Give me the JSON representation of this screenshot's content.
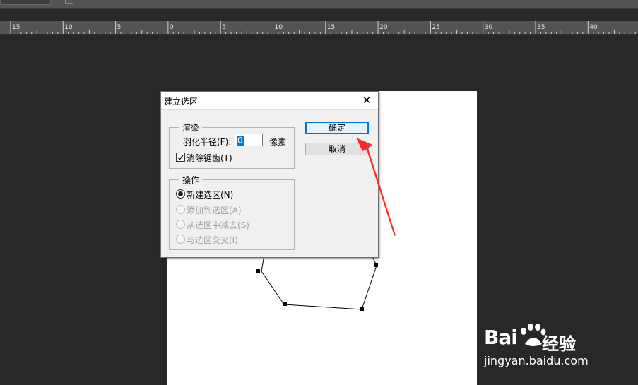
{
  "ruler": {
    "labels": [
      "15",
      "10",
      "5",
      "0",
      "5",
      "10",
      "15",
      "20",
      "25",
      "30",
      "35",
      "40"
    ]
  },
  "dialog": {
    "title": "建立选区",
    "close_glyph": "✕",
    "render_group": {
      "legend": "渲染",
      "feather_label": "羽化半径(F):",
      "feather_value": "0",
      "feather_unit": "像素",
      "antialias_label": "消除锯齿(T)",
      "antialias_checked": true
    },
    "operation_group": {
      "legend": "操作",
      "options": [
        {
          "label": "新建选区(N)",
          "selected": true,
          "enabled": true
        },
        {
          "label": "添加到选区(A)",
          "selected": false,
          "enabled": false
        },
        {
          "label": "从选区中减去(S)",
          "selected": false,
          "enabled": false
        },
        {
          "label": "与选区交叉(I)",
          "selected": false,
          "enabled": false
        }
      ]
    },
    "ok_label": "确定",
    "cancel_label": "取消"
  },
  "annotation": {
    "arrow_color": "#ff2a2a"
  },
  "watermark": {
    "brand": "Bai",
    "brand_suffix": "经验",
    "url": "jingyan.baidu.com"
  }
}
